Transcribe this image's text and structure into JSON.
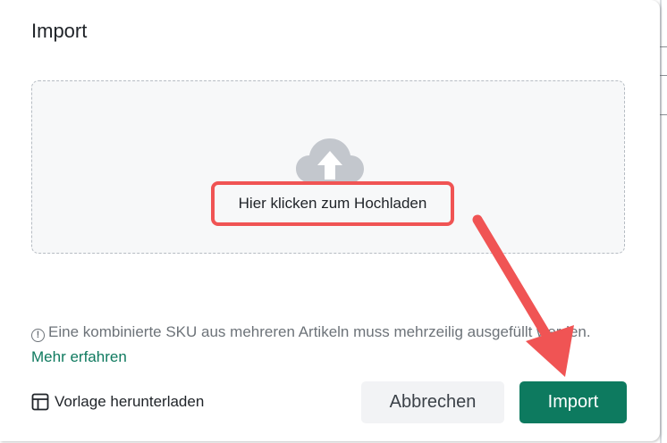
{
  "dialog": {
    "title": "Import",
    "dropzone": {
      "icon": "cloud-upload-icon",
      "label": "Hier klicken zum Hochladen"
    },
    "note": {
      "icon": "info-icon",
      "text": "Eine kombinierte SKU aus mehreren Artikeln muss mehrzeilig ausgefüllt werden.",
      "link": "Mehr erfahren"
    },
    "template_link": {
      "icon": "table-icon",
      "label": "Vorlage herunterladen"
    },
    "buttons": {
      "cancel": "Abbrechen",
      "import": "Import"
    }
  },
  "colors": {
    "primary": "#0d7a5f",
    "annotation": "#f05454"
  }
}
